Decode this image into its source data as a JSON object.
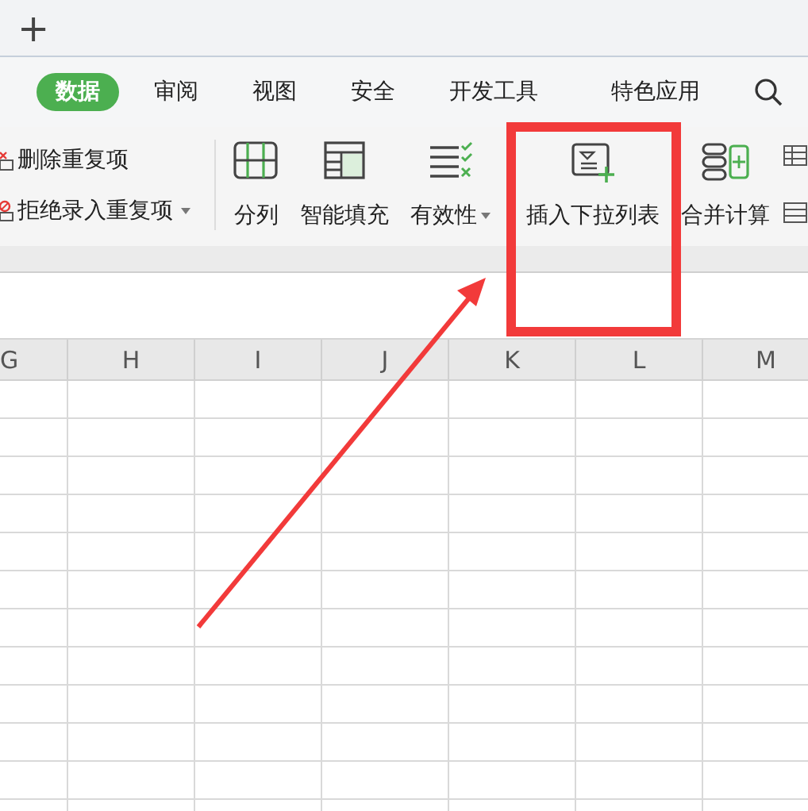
{
  "tab_bar": {
    "new_tab": "+"
  },
  "menu": [
    {
      "label": "数据",
      "selected": true
    },
    {
      "label": "审阅",
      "selected": false
    },
    {
      "label": "视图",
      "selected": false
    },
    {
      "label": "安全",
      "selected": false
    },
    {
      "label": "开发工具",
      "selected": false
    },
    {
      "label": "特色应用",
      "selected": false
    }
  ],
  "ribbon": {
    "small_items": [
      {
        "label": "删除重复项",
        "kind": "delete",
        "dropdown": false
      },
      {
        "label": "拒绝录入重复项",
        "kind": "reject",
        "dropdown": true
      }
    ],
    "large_items": [
      {
        "label": "分列",
        "kind": "split",
        "dropdown": false
      },
      {
        "label": "智能填充",
        "kind": "fill",
        "dropdown": false
      },
      {
        "label": "有效性",
        "kind": "validity",
        "dropdown": true
      },
      {
        "label": "插入下拉列表",
        "kind": "dropdown-list",
        "dropdown": false
      },
      {
        "label": "合并计算",
        "kind": "merge",
        "dropdown": false
      }
    ]
  },
  "sheet": {
    "columns": [
      "G",
      "H",
      "I",
      "J",
      "K",
      "L",
      "M"
    ]
  },
  "annotations": {
    "highlight_box": true,
    "arrow": true
  }
}
